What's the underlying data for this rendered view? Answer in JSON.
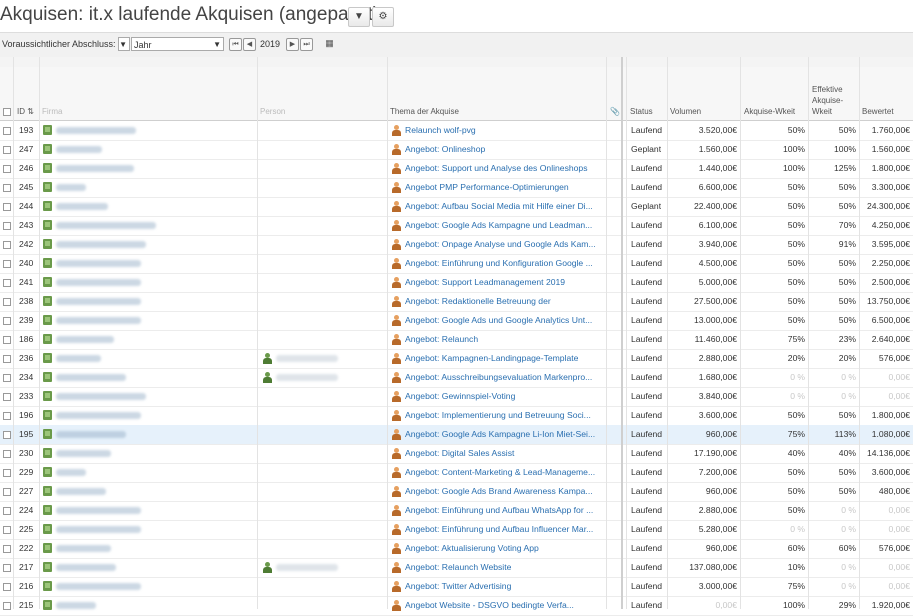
{
  "header": {
    "title": "Akquisen: it.x laufende Akquisen (angepasst)",
    "dropdown_icon": "caret-down-icon",
    "settings_icon": "gear-icon"
  },
  "filter": {
    "label": "Voraussichtlicher Abschluss:",
    "period_select": "Jahr",
    "year": "2019"
  },
  "columns": {
    "id": "ID",
    "firma": "Firma",
    "person": "Person",
    "thema": "Thema der Akquise",
    "status": "Status",
    "volumen": "Volumen",
    "wkeit": "Akquise-Wkeit",
    "eff1": "Effektive",
    "eff2": "Akquise-",
    "eff3": "Wkeit",
    "bewertet": "Bewertet"
  },
  "rows": [
    {
      "id": "193",
      "thema": "Relaunch wolf-pvg",
      "status": "Laufend",
      "volumen": "3.520,00€",
      "wkeit": "50%",
      "eff": "50%",
      "bewertet": "1.760,00€",
      "bold": true
    },
    {
      "id": "247",
      "thema": "Angebot: Onlineshop",
      "status": "Geplant",
      "volumen": "1.560,00€",
      "wkeit": "100%",
      "eff": "100%",
      "bewertet": "1.560,00€"
    },
    {
      "id": "246",
      "thema": "Angebot: Support und Analyse des Onlineshops",
      "status": "Laufend",
      "volumen": "1.440,00€",
      "wkeit": "100%",
      "eff": "125%",
      "bewertet": "1.800,00€",
      "bold": true
    },
    {
      "id": "245",
      "thema": "Angebot PMP Performance-Optimierungen",
      "status": "Laufend",
      "volumen": "6.600,00€",
      "wkeit": "50%",
      "eff": "50%",
      "bewertet": "3.300,00€"
    },
    {
      "id": "244",
      "thema": "Angebot: Aufbau Social Media mit Hilfe einer Di...",
      "status": "Geplant",
      "volumen": "22.400,00€",
      "wkeit": "50%",
      "eff": "50%",
      "bewertet": "24.300,00€"
    },
    {
      "id": "243",
      "thema": "Angebot: Google Ads Kampagne und Leadman...",
      "status": "Laufend",
      "volumen": "6.100,00€",
      "wkeit": "50%",
      "eff": "70%",
      "bewertet": "4.250,00€"
    },
    {
      "id": "242",
      "thema": "Angebot: Onpage Analyse und Google Ads Kam...",
      "status": "Laufend",
      "volumen": "3.940,00€",
      "wkeit": "50%",
      "eff": "91%",
      "bewertet": "3.595,00€"
    },
    {
      "id": "240",
      "thema": "Angebot: Einführung und Konfiguration Google ...",
      "status": "Laufend",
      "volumen": "4.500,00€",
      "wkeit": "50%",
      "eff": "50%",
      "bewertet": "2.250,00€"
    },
    {
      "id": "241",
      "thema": "Angebot: Support Leadmanagement 2019",
      "status": "Laufend",
      "volumen": "5.000,00€",
      "wkeit": "50%",
      "eff": "50%",
      "bewertet": "2.500,00€"
    },
    {
      "id": "238",
      "thema": "Angebot: Redaktionelle Betreuung der",
      "status": "Laufend",
      "volumen": "27.500,00€",
      "wkeit": "50%",
      "eff": "50%",
      "bewertet": "13.750,00€"
    },
    {
      "id": "239",
      "thema": "Angebot: Google Ads und Google Analytics Unt...",
      "status": "Laufend",
      "volumen": "13.000,00€",
      "wkeit": "50%",
      "eff": "50%",
      "bewertet": "6.500,00€"
    },
    {
      "id": "186",
      "thema": "Angebot: Relaunch",
      "status": "Laufend",
      "volumen": "11.460,00€",
      "wkeit": "75%",
      "eff": "23%",
      "bewertet": "2.640,00€"
    },
    {
      "id": "236",
      "thema": "Angebot: Kampagnen-Landingpage-Template",
      "status": "Laufend",
      "volumen": "2.880,00€",
      "wkeit": "20%",
      "eff": "20%",
      "bewertet": "576,00€",
      "person": true
    },
    {
      "id": "234",
      "thema": "Angebot: Ausschreibungsevaluation Markenpro...",
      "status": "Laufend",
      "volumen": "1.680,00€",
      "wkeit": "0 %",
      "eff": "0 %",
      "bewertet": "0,00€",
      "muted": true,
      "person": true
    },
    {
      "id": "233",
      "thema": "Angebot: Gewinnspiel-Voting",
      "status": "Laufend",
      "volumen": "3.840,00€",
      "wkeit": "0 %",
      "eff": "0 %",
      "bewertet": "0,00€",
      "muted": true
    },
    {
      "id": "196",
      "thema": "Angebot: Implementierung und Betreuung Soci...",
      "status": "Laufend",
      "volumen": "3.600,00€",
      "wkeit": "50%",
      "eff": "50%",
      "bewertet": "1.800,00€"
    },
    {
      "id": "195",
      "thema": "Angebot: Google Ads Kampagne Li-Ion Miet-Sei...",
      "status": "Laufend",
      "volumen": "960,00€",
      "wkeit": "75%",
      "eff": "113%",
      "bewertet": "1.080,00€",
      "selected": true
    },
    {
      "id": "230",
      "thema": "Angebot: Digital Sales Assist",
      "status": "Laufend",
      "volumen": "17.190,00€",
      "wkeit": "40%",
      "eff": "40%",
      "bewertet": "14.136,00€"
    },
    {
      "id": "229",
      "thema": "Angebot: Content-Marketing & Lead-Manageme...",
      "status": "Laufend",
      "volumen": "7.200,00€",
      "wkeit": "50%",
      "eff": "50%",
      "bewertet": "3.600,00€"
    },
    {
      "id": "227",
      "thema": "Angebot: Google Ads Brand Awareness Kampa...",
      "status": "Laufend",
      "volumen": "960,00€",
      "wkeit": "50%",
      "eff": "50%",
      "bewertet": "480,00€"
    },
    {
      "id": "224",
      "thema": "Angebot: Einführung und Aufbau WhatsApp for ...",
      "status": "Laufend",
      "volumen": "2.880,00€",
      "wkeit": "50%",
      "eff": "0 %",
      "bewertet": "0,00€",
      "mutedEff": true
    },
    {
      "id": "225",
      "thema": "Angebot: Einführung und Aufbau Influencer Mar...",
      "status": "Laufend",
      "volumen": "5.280,00€",
      "wkeit": "0 %",
      "eff": "0 %",
      "bewertet": "0,00€",
      "muted": true
    },
    {
      "id": "222",
      "thema": "Angebot: Aktualisierung Voting App",
      "status": "Laufend",
      "volumen": "960,00€",
      "wkeit": "60%",
      "eff": "60%",
      "bewertet": "576,00€"
    },
    {
      "id": "217",
      "thema": "Angebot: Relaunch Website",
      "status": "Laufend",
      "volumen": "137.080,00€",
      "wkeit": "10%",
      "eff": "0 %",
      "bewertet": "0,00€",
      "mutedEff": true,
      "person": true
    },
    {
      "id": "216",
      "thema": "Angebot: Twitter Advertising",
      "status": "Laufend",
      "volumen": "3.000,00€",
      "wkeit": "75%",
      "eff": "0 %",
      "bewertet": "0,00€",
      "mutedEff": true
    },
    {
      "id": "215",
      "thema": "Angebot Website - DSGVO bedingte Verfa...",
      "status": "Laufend",
      "volumen": "0,00€",
      "wkeit": "100%",
      "eff": "29%",
      "bewertet": "1.920,00€",
      "mutedVol": true
    }
  ]
}
